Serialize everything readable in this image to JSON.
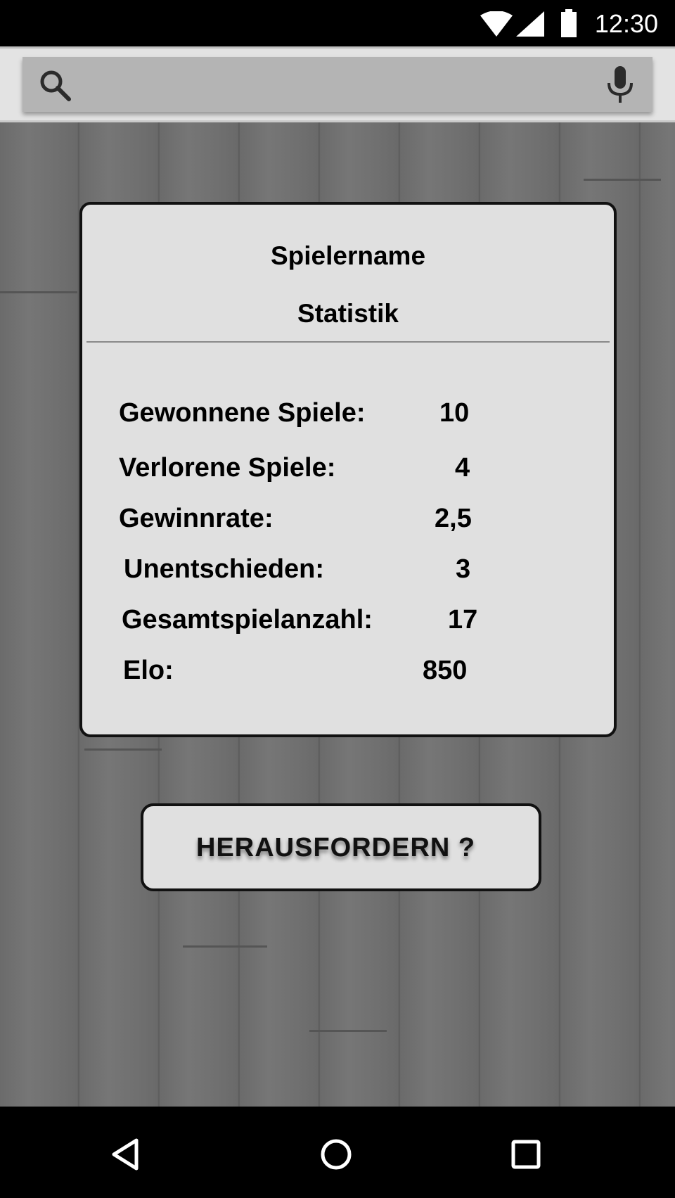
{
  "status_bar": {
    "time": "12:30",
    "icons": [
      "wifi-icon",
      "signal-icon",
      "battery-icon"
    ]
  },
  "search": {
    "value": "",
    "placeholder": "",
    "icons": [
      "search-icon",
      "mic-icon"
    ]
  },
  "card": {
    "player_name": "Spielername",
    "section_title": "Statistik",
    "stats": [
      {
        "label": "Gewonnene Spiele:",
        "value": "10"
      },
      {
        "label": "Verlorene Spiele:",
        "value": "4"
      },
      {
        "label": "Gewinnrate:",
        "value": "2,5"
      },
      {
        "label": "Unentschieden:",
        "value": "3"
      },
      {
        "label": "Gesamtspielanzahl:",
        "value": "17"
      },
      {
        "label": "Elo:",
        "value": "850"
      }
    ]
  },
  "challenge_button": {
    "label": "HERAUSFORDERN ?"
  },
  "nav_bar": {
    "icons": [
      "back-icon",
      "home-icon",
      "recents-icon"
    ]
  },
  "colors": {
    "status_bar": "#000000",
    "search_bar_bg": "#e3e3e3",
    "search_box": "#b4b4b4",
    "wood_background": "#6f6f6f",
    "card_bg": "#e0e0e0",
    "border": "#111111"
  }
}
